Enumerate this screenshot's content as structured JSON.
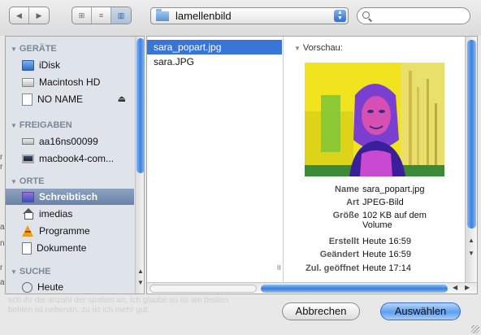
{
  "toolbar": {
    "nav_back": "◀",
    "nav_forward": "▶",
    "view_icons": "⊞",
    "view_list": "≡",
    "view_columns": "▥",
    "folder_name": "lamellenbild",
    "search_placeholder": ""
  },
  "sidebar": {
    "sections": [
      {
        "title": "GERÄTE",
        "items": [
          "iDisk",
          "Macintosh HD",
          "NO NAME"
        ]
      },
      {
        "title": "FREIGABEN",
        "items": [
          "aa16ns00099",
          "macbook4-com..."
        ]
      },
      {
        "title": "ORTE",
        "items": [
          "Schreibtisch",
          "imedias",
          "Programme",
          "Dokumente"
        ]
      },
      {
        "title": "SUCHE",
        "items": [
          "Heute"
        ]
      }
    ],
    "selected_item": "Schreibtisch",
    "eject_symbol": "⏏",
    "scroll_up": "▲",
    "scroll_down": "▼"
  },
  "browser": {
    "files": [
      "sara_popart.jpg",
      "sara.JPG"
    ],
    "selected_file": "sara_popart.jpg",
    "column_resize_mark": "II",
    "preview_title": "Vorschau:",
    "info": [
      {
        "key": "Name",
        "value": "sara_popart.jpg"
      },
      {
        "key": "Art",
        "value": "JPEG-Bild"
      },
      {
        "key": "Größe",
        "value": "102 KB auf dem Volume"
      },
      {
        "key": "Erstellt",
        "value": "Heute 16:59"
      },
      {
        "key": "Geändert",
        "value": "Heute 16:59"
      },
      {
        "key": "Zul. geöffnet",
        "value": "Heute 17:14"
      }
    ],
    "h_scroll_left": "◀",
    "h_scroll_right": "▶",
    "v_scroll_up": "▲",
    "v_scroll_down": "▼"
  },
  "buttons": {
    "cancel": "Abbrechen",
    "choose": "Auswählen"
  },
  "background": {
    "fragments": [
      "r",
      "r",
      "a",
      "n",
      "r",
      "a"
    ],
    "text_line1": "ach ihr die anzahl der spalten an, ich glaube so ist am besten",
    "text_line2": "bohlen ist nebenan. zu ist ich mehr gut."
  },
  "colors": {
    "selection_blue": "#3875d7",
    "sidebar_bg": "#dee4ea",
    "scroll_blue": "#3d82e0",
    "photo_yellow": "#f1e41e"
  }
}
